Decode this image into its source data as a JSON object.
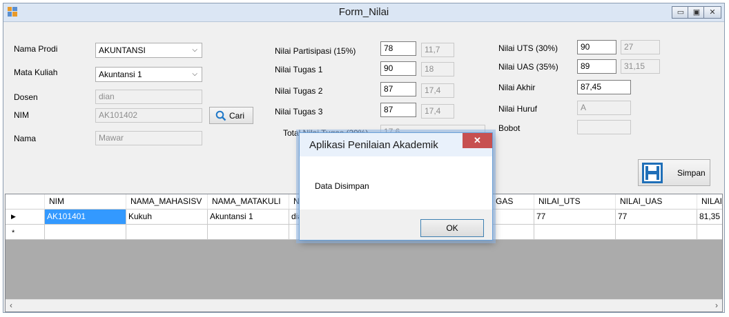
{
  "window": {
    "title": "Form_Nilai",
    "minimize": "▭",
    "maximize": "▣",
    "close": "✕"
  },
  "left": {
    "prodi_label": "Nama Prodi",
    "prodi_value": "AKUNTANSI",
    "matkul_label": "Mata Kuliah",
    "matkul_value": "Akuntansi 1",
    "dosen_label": "Dosen",
    "dosen_value": "dian",
    "nim_label": "NIM",
    "nim_value": "AK101402",
    "nama_label": "Nama",
    "nama_value": "Mawar",
    "cari_label": "Cari"
  },
  "middle": {
    "partisipasi_label": "Nilai Partisipasi (15%)",
    "partisipasi_value": "78",
    "partisipasi_weighted": "11,7",
    "tugas1_label": "Nilai Tugas 1",
    "tugas1_value": "90",
    "tugas1_weighted": "18",
    "tugas2_label": "Nilai Tugas 2",
    "tugas2_value": "87",
    "tugas2_weighted": "17,4",
    "tugas3_label": "Nilai Tugas 3",
    "tugas3_value": "87",
    "tugas3_weighted": "17,4",
    "total_label": "Total Nilai Tugas (20%)",
    "total_value": "17,6"
  },
  "right": {
    "uts_label": "Nilai UTS (30%)",
    "uts_value": "90",
    "uts_weighted": "27",
    "uas_label": "Nilai UAS (35%)",
    "uas_value": "89",
    "uas_weighted": "31,15",
    "akhir_label": "Nilai Akhir",
    "akhir_value": "87,45",
    "huruf_label": "Nilai Huruf",
    "huruf_value": "A",
    "bobot_label": "Bobot",
    "bobot_value": "",
    "simpan_label": "Simpan"
  },
  "grid": {
    "columns": [
      "NIM",
      "NAMA_MAHASISV",
      "NAMA_MATAKULI",
      "N",
      "GAS",
      "NILAI_UTS",
      "NILAI_UAS",
      "NILAI_"
    ],
    "row1": [
      "AK101401",
      "Kukuh",
      "Akuntansi 1",
      "dia",
      "",
      "77",
      "77",
      "81,35"
    ],
    "current_marker": "▶",
    "new_marker": "*"
  },
  "dialog": {
    "title": "Aplikasi Penilaian Akademik",
    "message": "Data Disimpan",
    "ok": "OK",
    "close": "✕"
  },
  "colors": {
    "accent": "#3399ff",
    "save_icon": "#1f6fb8",
    "close_red": "#c75050"
  }
}
